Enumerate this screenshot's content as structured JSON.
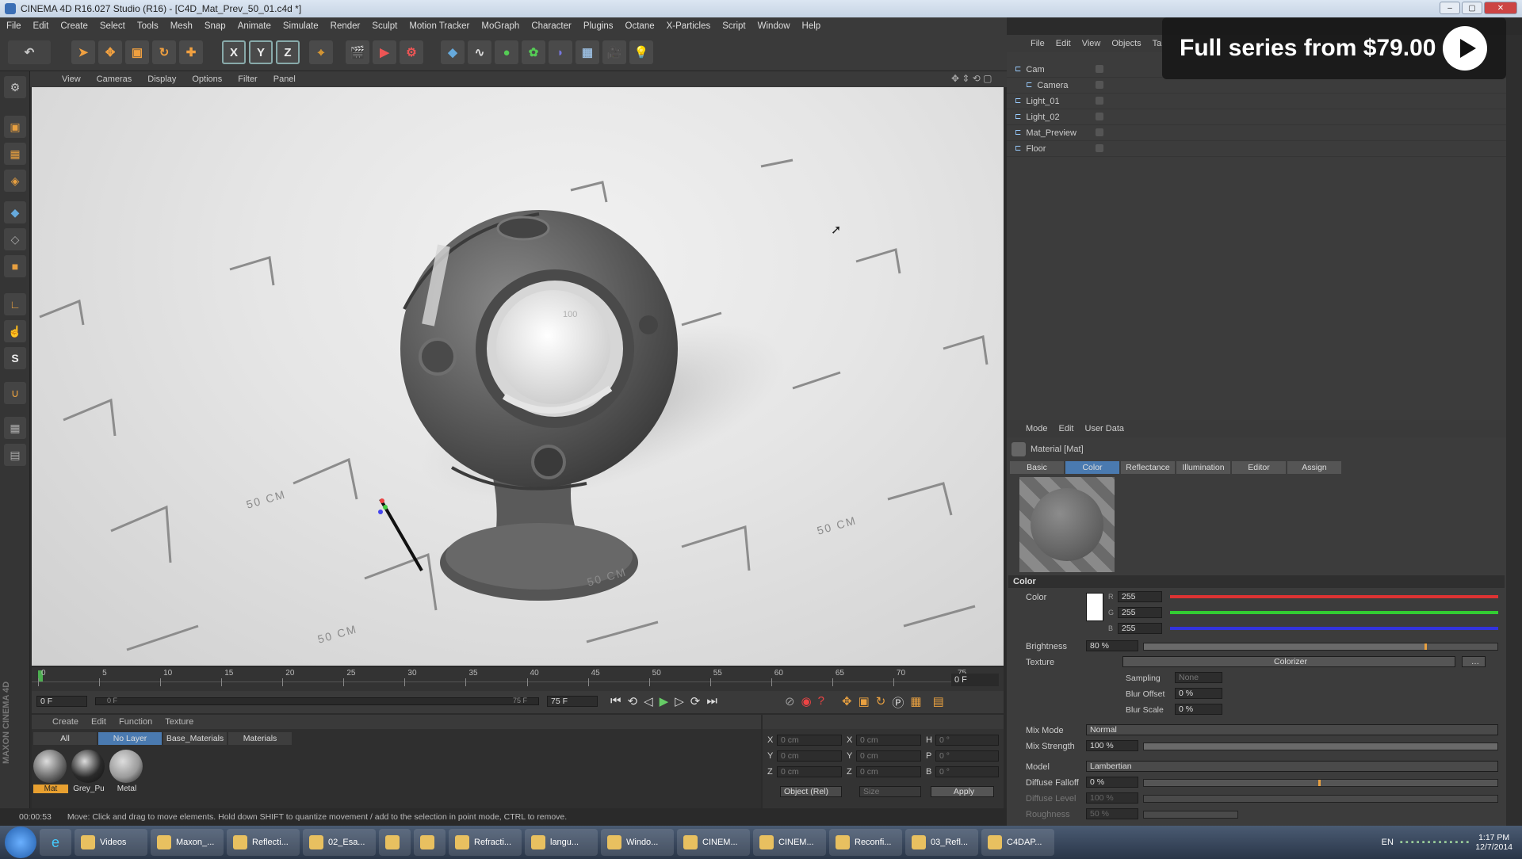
{
  "window": {
    "title": "CINEMA 4D R16.027 Studio (R16) - [C4D_Mat_Prev_50_01.c4d *]"
  },
  "menubar": [
    "File",
    "Edit",
    "Create",
    "Select",
    "Tools",
    "Mesh",
    "Snap",
    "Animate",
    "Simulate",
    "Render",
    "Sculpt",
    "Motion Tracker",
    "MoGraph",
    "Character",
    "Plugins",
    "Octane",
    "X-Particles",
    "Script",
    "Window",
    "Help"
  ],
  "toolbar": {
    "x_axis": "X",
    "y_axis": "Y",
    "z_axis": "Z"
  },
  "viewport": {
    "menu": [
      "View",
      "Cameras",
      "Display",
      "Options",
      "Filter",
      "Panel"
    ],
    "floor_labels": [
      "50 CM",
      "50 CM",
      "50 CM",
      "50 CM"
    ],
    "dial_text": "100"
  },
  "timeline": {
    "ticks": [
      "0",
      "5",
      "10",
      "15",
      "20",
      "25",
      "30",
      "35",
      "40",
      "45",
      "50",
      "55",
      "60",
      "65",
      "70",
      "75"
    ],
    "end_frame": "0 F",
    "current": "0 F",
    "range_start": "0 F",
    "range_end": "75 F",
    "max": "75 F"
  },
  "material_manager": {
    "menu": [
      "Create",
      "Edit",
      "Function",
      "Texture"
    ],
    "tabs": [
      "All",
      "No Layer",
      "Base_Materials",
      "Materials"
    ],
    "materials": [
      {
        "name": "Mat",
        "color": "#6a6a6a"
      },
      {
        "name": "Grey_Pu",
        "color": "#2a2a2a"
      },
      {
        "name": "Metal",
        "color": "#9a9a9a"
      }
    ]
  },
  "coord_manager": {
    "rows": [
      {
        "axis": "X",
        "pos": "0 cm",
        "axis2": "X",
        "size": "0 cm",
        "axis3": "H",
        "rot": "0 °"
      },
      {
        "axis": "Y",
        "pos": "0 cm",
        "axis2": "Y",
        "size": "0 cm",
        "axis3": "P",
        "rot": "0 °"
      },
      {
        "axis": "Z",
        "pos": "0 cm",
        "axis2": "Z",
        "size": "0 cm",
        "axis3": "B",
        "rot": "0 °"
      }
    ],
    "mode": "Object (Rel)",
    "size_mode": "Size",
    "apply": "Apply"
  },
  "object_manager": {
    "menu": [
      "File",
      "Edit",
      "View",
      "Objects",
      "Ta"
    ],
    "objects": [
      {
        "name": "Cam",
        "indent": 0
      },
      {
        "name": "Camera",
        "indent": 1
      },
      {
        "name": "Light_01",
        "indent": 0
      },
      {
        "name": "Light_02",
        "indent": 0
      },
      {
        "name": "Mat_Preview",
        "indent": 0
      },
      {
        "name": "Floor",
        "indent": 0
      }
    ]
  },
  "attribute_manager": {
    "menu": [
      "Mode",
      "Edit",
      "User Data"
    ],
    "title": "Material [Mat]",
    "tabs": [
      "Basic",
      "Color",
      "Reflectance",
      "Illumination",
      "Editor",
      "Assign"
    ],
    "active_tab": "Color",
    "section": "Color",
    "color_label": "Color",
    "r": "255",
    "g": "255",
    "b": "255",
    "r_label": "R",
    "g_label": "G",
    "b_label": "B",
    "brightness_label": "Brightness",
    "brightness": "80 %",
    "brightness_level": 0.8,
    "texture_label": "Texture",
    "texture_value": "Colorizer",
    "sampling_label": "Sampling",
    "sampling": "None",
    "blur_offset_label": "Blur Offset",
    "blur_offset": "0 %",
    "blur_scale_label": "Blur Scale",
    "blur_scale": "0 %",
    "mix_mode_label": "Mix Mode",
    "mix_mode": "Normal",
    "mix_strength_label": "Mix Strength",
    "mix_strength": "100 %",
    "model_label": "Model",
    "model": "Lambertian",
    "diffuse_falloff_label": "Diffuse Falloff",
    "diffuse_falloff": "0 %",
    "diffuse_level_label": "Diffuse Level",
    "diffuse_level": "100 %",
    "roughness_label": "Roughness",
    "roughness": "50 %"
  },
  "status": {
    "time": "00:00:53",
    "message": "Move: Click and drag to move elements. Hold down SHIFT to quantize movement / add to the selection in point mode, CTRL to remove."
  },
  "promo": {
    "text": "Full series from $79.00"
  },
  "taskbar": {
    "items": [
      "Videos",
      "Maxon_...",
      "Reflecti...",
      "02_Esa...",
      "",
      "",
      "Refracti...",
      "langu...",
      "Windo...",
      "CINEM...",
      "CINEM...",
      "Reconfi...",
      "03_Refl...",
      "C4DAP..."
    ],
    "lang": "EN",
    "clock_time": "1:17 PM",
    "clock_date": "12/7/2014"
  },
  "brand": "MAXON CINEMA 4D"
}
